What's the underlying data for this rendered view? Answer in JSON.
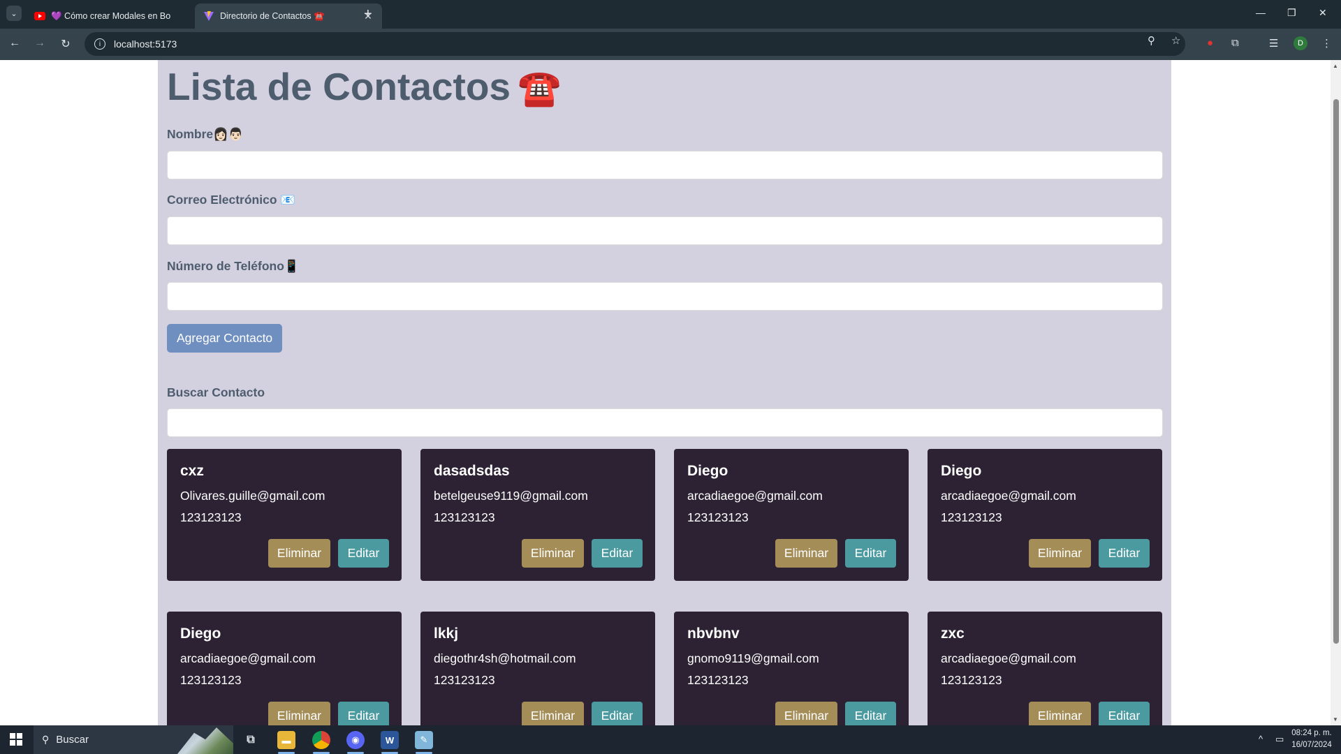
{
  "browser": {
    "tabs": [
      {
        "title": "💜 Cómo crear Modales en Bo",
        "favicon": "youtube-icon",
        "active": false
      },
      {
        "title": "Directorio de Contactos ☎️",
        "favicon": "vite-icon",
        "active": true
      }
    ],
    "url": "localhost:5173",
    "profile_initial": "D"
  },
  "page": {
    "title": "Lista de Contactos",
    "title_emoji": "☎️",
    "form": {
      "name_label": "Nombre👩🏻‍👨🏻",
      "email_label": "Correo Electrónico 📧",
      "phone_label": "Número de Teléfono📱",
      "name_value": "",
      "email_value": "",
      "phone_value": "",
      "add_button": "Agregar Contacto"
    },
    "search": {
      "label": "Buscar Contacto",
      "value": ""
    },
    "contacts": [
      {
        "name": "cxz",
        "email": "Olivares.guille@gmail.com",
        "phone": "123123123",
        "delete_label": "Eliminar",
        "edit_label": "Editar"
      },
      {
        "name": "dasadsdas",
        "email": "betelgeuse9119@gmail.com",
        "phone": "123123123",
        "delete_label": "Eliminar",
        "edit_label": "Editar"
      },
      {
        "name": "Diego",
        "email": "arcadiaegoe@gmail.com",
        "phone": "123123123",
        "delete_label": "Eliminar",
        "edit_label": "Editar"
      },
      {
        "name": "Diego",
        "email": "arcadiaegoe@gmail.com",
        "phone": "123123123",
        "delete_label": "Eliminar",
        "edit_label": "Editar"
      },
      {
        "name": "Diego",
        "email": "arcadiaegoe@gmail.com",
        "phone": "123123123",
        "delete_label": "Eliminar",
        "edit_label": "Editar"
      },
      {
        "name": "lkkj",
        "email": "diegothr4sh@hotmail.com",
        "phone": "123123123",
        "delete_label": "Eliminar",
        "edit_label": "Editar"
      },
      {
        "name": "nbvbnv",
        "email": "gnomo9119@gmail.com",
        "phone": "123123123",
        "delete_label": "Eliminar",
        "edit_label": "Editar"
      },
      {
        "name": "zxc",
        "email": "arcadiaegoe@gmail.com",
        "phone": "123123123",
        "delete_label": "Eliminar",
        "edit_label": "Editar"
      }
    ]
  },
  "taskbar": {
    "search_placeholder": "Buscar",
    "time": "08:24 p. m.",
    "date": "16/07/2024"
  },
  "colors": {
    "container_bg": "#d3d0e0",
    "heading": "#4e5d6e",
    "card_bg": "#2c2233",
    "delete_button": "#a58d58",
    "edit_button": "#4a9aa0",
    "add_button": "#6f8fc0"
  }
}
